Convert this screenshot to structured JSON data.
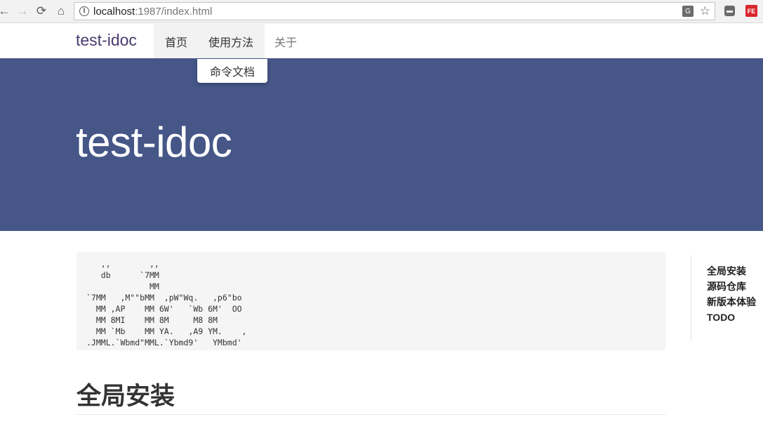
{
  "browser": {
    "back_icon": "arrow-left-icon",
    "forward_icon": "arrow-right-icon",
    "reload_icon": "reload-icon",
    "home_icon": "home-icon",
    "url_host": "localhost",
    "url_rest": ":1987/index.html"
  },
  "navbar": {
    "brand": "test-idoc",
    "items": [
      {
        "label": "首页"
      },
      {
        "label": "使用方法"
      },
      {
        "label": "关于"
      }
    ],
    "dropdown": {
      "items": [
        {
          "label": "命令文档"
        }
      ]
    }
  },
  "jumbotron": {
    "title": "test-idoc"
  },
  "code": {
    "ascii_art": "   ,,        ,,\n   db      `7MM\n             MM\n`7MM   ,M\"\"bMM  ,pW\"Wq.   ,p6\"bo\n  MM ,AP    MM 6W'   `Wb 6M'  OO\n  MM 8MI    MM 8M     M8 8M\n  MM `Mb    MM YA.   ,A9 YM.    ,\n.JMML.`Wbmd\"MML.`Ybmd9'   YMbmd'"
  },
  "toc": {
    "items": [
      {
        "label": "全局安装"
      },
      {
        "label": "源码仓库"
      },
      {
        "label": "新版本体验"
      },
      {
        "label": "TODO"
      }
    ]
  },
  "content": {
    "heading": "全局安装"
  },
  "colors": {
    "jumbotron_bg": "#455687",
    "brand": "#4a3a6e",
    "code_bg": "#f5f5f6"
  }
}
